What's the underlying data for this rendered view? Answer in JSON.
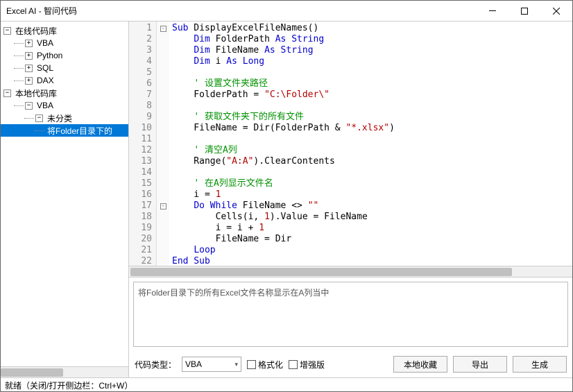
{
  "title": "Excel AI - 智问代码",
  "tree": {
    "online": {
      "label": "在线代码库",
      "children": [
        "VBA",
        "Python",
        "SQL",
        "DAX"
      ]
    },
    "local": {
      "label": "本地代码库",
      "vba": "VBA",
      "uncat": "未分类",
      "item": "将Folder目录下的"
    }
  },
  "code": [
    {
      "n": 1,
      "fold": "-",
      "t": [
        {
          "c": "kw",
          "s": "Sub"
        },
        {
          "s": " DisplayExcelFileNames()"
        }
      ]
    },
    {
      "n": 2,
      "t": [
        {
          "s": "    "
        },
        {
          "c": "kw",
          "s": "Dim"
        },
        {
          "s": " FolderPath "
        },
        {
          "c": "kw",
          "s": "As String"
        }
      ]
    },
    {
      "n": 3,
      "t": [
        {
          "s": "    "
        },
        {
          "c": "kw",
          "s": "Dim"
        },
        {
          "s": " FileName "
        },
        {
          "c": "kw",
          "s": "As String"
        }
      ]
    },
    {
      "n": 4,
      "t": [
        {
          "s": "    "
        },
        {
          "c": "kw",
          "s": "Dim"
        },
        {
          "s": " i "
        },
        {
          "c": "kw",
          "s": "As Long"
        }
      ]
    },
    {
      "n": 5,
      "t": []
    },
    {
      "n": 6,
      "t": [
        {
          "s": "    "
        },
        {
          "c": "cmt",
          "s": "' 设置文件夹路径"
        }
      ]
    },
    {
      "n": 7,
      "t": [
        {
          "s": "    FolderPath = "
        },
        {
          "c": "str",
          "s": "\"C:\\Folder\\\""
        }
      ]
    },
    {
      "n": 8,
      "t": []
    },
    {
      "n": 9,
      "t": [
        {
          "s": "    "
        },
        {
          "c": "cmt",
          "s": "' 获取文件夹下的所有文件"
        }
      ]
    },
    {
      "n": 10,
      "t": [
        {
          "s": "    FileName = Dir(FolderPath & "
        },
        {
          "c": "str",
          "s": "\"*.xlsx\""
        },
        {
          "s": ")"
        }
      ]
    },
    {
      "n": 11,
      "t": []
    },
    {
      "n": 12,
      "t": [
        {
          "s": "    "
        },
        {
          "c": "cmt",
          "s": "' 清空A列"
        }
      ]
    },
    {
      "n": 13,
      "t": [
        {
          "s": "    Range("
        },
        {
          "c": "str",
          "s": "\"A:A\""
        },
        {
          "s": ").ClearContents"
        }
      ]
    },
    {
      "n": 14,
      "t": []
    },
    {
      "n": 15,
      "t": [
        {
          "s": "    "
        },
        {
          "c": "cmt",
          "s": "' 在A列显示文件名"
        }
      ]
    },
    {
      "n": 16,
      "t": [
        {
          "s": "    i = "
        },
        {
          "c": "str",
          "s": "1"
        }
      ]
    },
    {
      "n": 17,
      "fold": "-",
      "t": [
        {
          "s": "    "
        },
        {
          "c": "kw",
          "s": "Do While"
        },
        {
          "s": " FileName <> "
        },
        {
          "c": "str",
          "s": "\"\""
        }
      ]
    },
    {
      "n": 18,
      "t": [
        {
          "s": "        Cells(i, "
        },
        {
          "c": "str",
          "s": "1"
        },
        {
          "s": ").Value = FileName"
        }
      ]
    },
    {
      "n": 19,
      "t": [
        {
          "s": "        i = i + "
        },
        {
          "c": "str",
          "s": "1"
        }
      ]
    },
    {
      "n": 20,
      "t": [
        {
          "s": "        FileName = Dir"
        }
      ]
    },
    {
      "n": 21,
      "t": [
        {
          "s": "    "
        },
        {
          "c": "kw",
          "s": "Loop"
        }
      ]
    },
    {
      "n": 22,
      "t": [
        {
          "c": "kw",
          "s": "End Sub"
        }
      ]
    }
  ],
  "description": "将Folder目录下的所有Excel文件名称显示在A列当中",
  "toolbar": {
    "type_label": "代码类型：",
    "type_value": "VBA",
    "format": "格式化",
    "enhanced": "增强版",
    "local_fav": "本地收藏",
    "export": "导出",
    "generate": "生成"
  },
  "status": "就绪（关闭/打开侧边栏：Ctrl+W）"
}
